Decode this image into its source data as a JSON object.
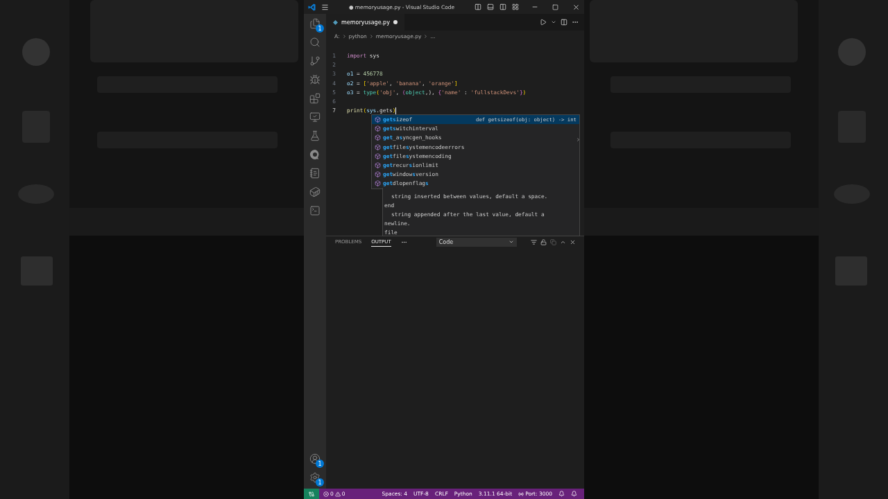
{
  "title_bar": {
    "title": "● memoryusage.py - Visual Studio Code"
  },
  "activity_bar": {
    "top": [
      {
        "kind": "explorer",
        "badge": "1"
      },
      {
        "kind": "search"
      },
      {
        "kind": "source-control"
      },
      {
        "kind": "run-debug"
      },
      {
        "kind": "extensions"
      },
      {
        "kind": "remote"
      },
      {
        "kind": "testing"
      },
      {
        "kind": "q"
      },
      {
        "kind": "notebook"
      },
      {
        "kind": "docker"
      },
      {
        "kind": "terminal"
      }
    ],
    "bottom": [
      {
        "kind": "accounts",
        "badge": "1"
      },
      {
        "kind": "settings",
        "badge": "1"
      }
    ]
  },
  "editor": {
    "tabs": [
      {
        "label": "memoryusage.py",
        "selected": true,
        "modified": true
      }
    ],
    "breadcrumb": [
      "A:",
      "python",
      "memoryusage.py",
      "..."
    ],
    "lines": [
      {
        "number": "1",
        "current": false,
        "tokens": [
          {
            "kind": "keyword",
            "text": "import"
          },
          {
            "kind": "plain",
            "text": " sys"
          }
        ]
      },
      {
        "number": "2",
        "current": false
      },
      {
        "number": "3",
        "current": false,
        "tokens": [
          {
            "kind": "variable",
            "text": "o1"
          },
          {
            "kind": "plain",
            "text": " = "
          },
          {
            "kind": "number",
            "text": "456778"
          }
        ]
      },
      {
        "number": "4",
        "current": false,
        "tokens": [
          {
            "kind": "variable",
            "text": "o2"
          },
          {
            "kind": "plain",
            "text": " = "
          },
          {
            "kind": "bracket1",
            "text": "["
          },
          {
            "kind": "string",
            "text": "'apple'"
          },
          {
            "kind": "plain",
            "text": ", "
          },
          {
            "kind": "string",
            "text": "'banana'"
          },
          {
            "kind": "plain",
            "text": ", "
          },
          {
            "kind": "string",
            "text": "'orange'"
          },
          {
            "kind": "bracket1",
            "text": "]"
          }
        ]
      },
      {
        "number": "5",
        "current": false,
        "tokens": [
          {
            "kind": "variable",
            "text": "o3"
          },
          {
            "kind": "plain",
            "text": " = "
          },
          {
            "kind": "type",
            "text": "type"
          },
          {
            "kind": "bracket1",
            "text": "("
          },
          {
            "kind": "string",
            "text": "'obj'"
          },
          {
            "kind": "plain",
            "text": ", "
          },
          {
            "kind": "bracket2",
            "text": "("
          },
          {
            "kind": "type",
            "text": "object"
          },
          {
            "kind": "plain",
            "text": ",)"
          },
          {
            "kind": "plain",
            "text": ", "
          },
          {
            "kind": "bracket2",
            "text": "{"
          },
          {
            "kind": "string",
            "text": "'name'"
          },
          {
            "kind": "plain",
            "text": " : "
          },
          {
            "kind": "string",
            "text": "'fullstackDevs'"
          },
          {
            "kind": "bracket2",
            "text": "}"
          },
          {
            "kind": "bracket1",
            "text": ")"
          }
        ]
      },
      {
        "number": "6",
        "current": false
      },
      {
        "number": "7",
        "current": true,
        "tokens": [
          {
            "kind": "function",
            "text": "print"
          },
          {
            "kind": "bracket1",
            "text": "("
          },
          {
            "kind": "variable",
            "text": "sys"
          },
          {
            "kind": "plain",
            "text": "."
          },
          {
            "kind": "plain",
            "text": "gets"
          },
          {
            "kind": "bracket1",
            "text": ")"
          }
        ]
      }
    ],
    "suggestions": {
      "detail": "def getsizeof(obj: object) -> int",
      "items": [
        {
          "selected": true,
          "parts": [
            {
              "text": "gets",
              "match": true
            },
            {
              "text": "izeof",
              "match": false
            }
          ]
        },
        {
          "selected": false,
          "parts": [
            {
              "text": "gets",
              "match": true
            },
            {
              "text": "witchinterval",
              "match": false
            }
          ]
        },
        {
          "selected": false,
          "parts": [
            {
              "text": "get",
              "match": true
            },
            {
              "text": "_a",
              "match": false
            },
            {
              "text": "s",
              "match": true
            },
            {
              "text": "yncgen_hooks",
              "match": false
            }
          ]
        },
        {
          "selected": false,
          "parts": [
            {
              "text": "get",
              "match": true
            },
            {
              "text": "file",
              "match": false
            },
            {
              "text": "s",
              "match": true
            },
            {
              "text": "ystemencodeerrors",
              "match": false
            }
          ]
        },
        {
          "selected": false,
          "parts": [
            {
              "text": "get",
              "match": true
            },
            {
              "text": "file",
              "match": false
            },
            {
              "text": "s",
              "match": true
            },
            {
              "text": "ystemencoding",
              "match": false
            }
          ]
        },
        {
          "selected": false,
          "parts": [
            {
              "text": "get",
              "match": true
            },
            {
              "text": "recur",
              "match": false
            },
            {
              "text": "s",
              "match": true
            },
            {
              "text": "ionlimit",
              "match": false
            }
          ]
        },
        {
          "selected": false,
          "parts": [
            {
              "text": "get",
              "match": true
            },
            {
              "text": "window",
              "match": false
            },
            {
              "text": "s",
              "match": true
            },
            {
              "text": "version",
              "match": false
            }
          ]
        },
        {
          "selected": false,
          "parts": [
            {
              "text": "get",
              "match": true
            },
            {
              "text": "dlopenflag",
              "match": false
            },
            {
              "text": "s",
              "match": true
            }
          ]
        }
      ]
    },
    "doc": [
      {
        "indent": true,
        "text": "string inserted between values, default a space."
      },
      {
        "indent": false,
        "text": "end"
      },
      {
        "indent": true,
        "text": "string appended after the last value, default a"
      },
      {
        "indent": false,
        "text": "newline."
      },
      {
        "indent": false,
        "text": "file"
      }
    ]
  },
  "panel": {
    "tabs": [
      {
        "label": "PROBLEMS",
        "selected": false
      },
      {
        "label": "OUTPUT",
        "selected": true
      }
    ],
    "dropdown": "Code"
  },
  "status_bar": {
    "errors": "0",
    "warnings": "0",
    "items": [
      "Spaces: 4",
      "UTF-8",
      "CRLF",
      "Python",
      "3.11.1 64-bit"
    ],
    "port": "Port: 3000"
  }
}
